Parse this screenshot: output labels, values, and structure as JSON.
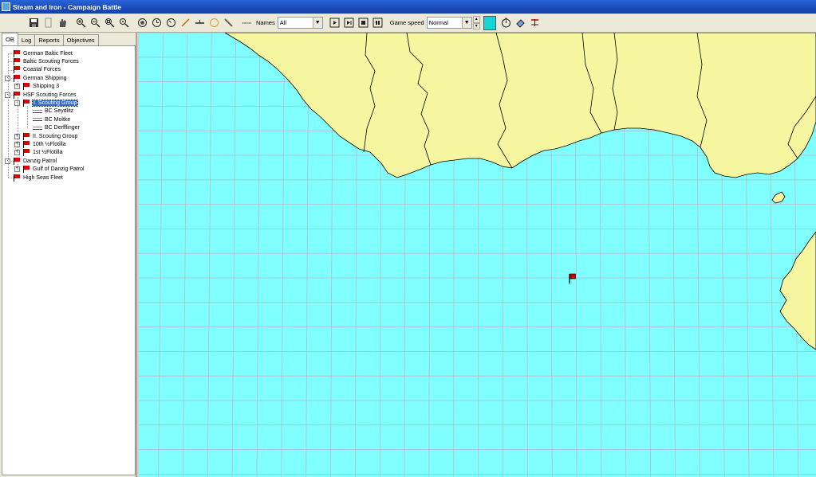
{
  "window": {
    "title": "Steam and Iron - Campaign Battle"
  },
  "toolbar": {
    "buttons": [
      "save-icon",
      "document-icon",
      "hand-icon",
      "zoom-in-icon",
      "zoom-out-icon",
      "zoom-fit-icon",
      "zoom-area-icon",
      "target-icon",
      "clock-icon",
      "clock-alt-icon",
      "line-icon",
      "course-icon",
      "circle-icon",
      "pencil-icon",
      "dotted-line-icon"
    ],
    "names_label": "Names",
    "names_value": "All",
    "game_speed_label": "Game speed",
    "game_speed_value": "Normal",
    "swatch_color": "#15d6d6"
  },
  "tabs": [
    "OB",
    "Log",
    "Reports",
    "Objectives"
  ],
  "tree": [
    {
      "label": "German Baltic Fleet",
      "depth": 0,
      "icon": "flag",
      "expander": ""
    },
    {
      "label": "Baltic Scouting Forces",
      "depth": 0,
      "icon": "flag",
      "expander": ""
    },
    {
      "label": "Coastal Forces",
      "depth": 0,
      "icon": "flag",
      "expander": ""
    },
    {
      "label": "German Shipping",
      "depth": 0,
      "icon": "flag",
      "expander": "-"
    },
    {
      "label": "Shipping 3",
      "depth": 1,
      "icon": "flag",
      "expander": "+"
    },
    {
      "label": "HSF Scouting Forces",
      "depth": 0,
      "icon": "flag",
      "expander": "-"
    },
    {
      "label": "I. Scouting Group",
      "depth": 1,
      "icon": "flag",
      "expander": "-",
      "selected": true
    },
    {
      "label": "BC Seydlitz",
      "depth": 2,
      "icon": "ship",
      "expander": ""
    },
    {
      "label": "BC Moltke",
      "depth": 2,
      "icon": "ship",
      "expander": ""
    },
    {
      "label": "BC Derfflinger",
      "depth": 2,
      "icon": "ship",
      "expander": ""
    },
    {
      "label": "II. Scouting Group",
      "depth": 1,
      "icon": "flag",
      "expander": "+"
    },
    {
      "label": "10th ½Flotilla",
      "depth": 1,
      "icon": "flag",
      "expander": "+"
    },
    {
      "label": "1st ½Flotilla",
      "depth": 1,
      "icon": "flag",
      "expander": "+"
    },
    {
      "label": "Danzig Patrol",
      "depth": 0,
      "icon": "flag",
      "expander": "-"
    },
    {
      "label": "Gulf of Danzig Patrol",
      "depth": 1,
      "icon": "flag",
      "expander": "+"
    },
    {
      "label": "High Seas Fleet",
      "depth": 0,
      "icon": "flag",
      "expander": ""
    }
  ],
  "map": {
    "sea_color": "#80ffff",
    "land_color": "#f6f6a0",
    "grid_color": "#b9b9c8",
    "flag_marker": "flag-icon"
  }
}
